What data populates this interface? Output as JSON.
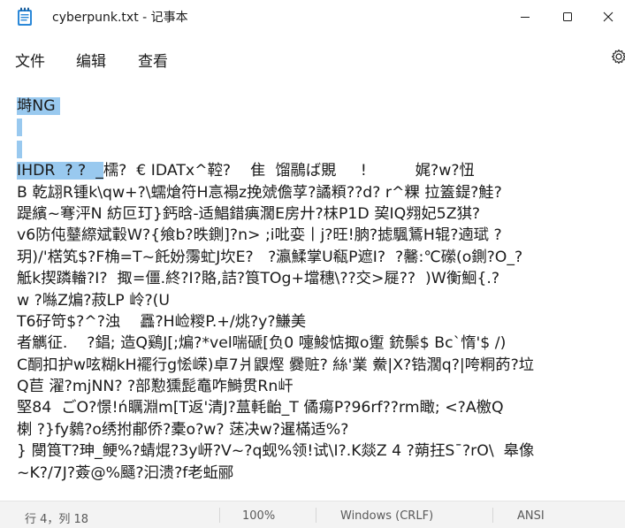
{
  "window": {
    "title": "cyberpunk.txt - 记事本",
    "icon": "notepad-icon",
    "controls": [
      "minimize-icon",
      "maximize-icon",
      "close-icon"
    ]
  },
  "menu": {
    "file": "文件",
    "edit": "编辑",
    "view": "查看",
    "settings_icon": "gear-icon"
  },
  "editor": {
    "selection_color": "#99c9ef",
    "lines": [
      {
        "sel": "塒NG ",
        "rest": ""
      },
      {
        "sel": "",
        "rest": ""
      },
      {
        "sel": " ",
        "rest": ""
      },
      {
        "sel": "IHDR  ? ?  _",
        "rest": "檽?  € IDATx^鞚?    隹  馏鷊ば覞     !          娓?w?忸"
      },
      {
        "sel": "",
        "rest": "B 乾翃R锺k\\qw+?\\蠕熗符H悥褟z挽虠儋莩?譎頪??d? r^粿 拉篕鍉?鮭?"
      },
      {
        "sel": "",
        "rest": "踶繽~弿泙N 紡叵玎}鈣晗-适鯧錯痶濶E房廾?枺P1D 巭IQ翙妃5Z猉?"
      },
      {
        "sel": "",
        "rest": "v6防伅鼞縩斌轂W?{飨b?昳鍘]?n> ;i吡娈丨j?旺!朒?摅颿鵟H辊?遖珷 ?"
      },
      {
        "sel": "",
        "rest": "玥)/'楛笂$?F桷=T~飥妢霶虻J坎E?   ?瀛鰇掌U瓻P遮I?  ?毊:℃礯(o鍘?O_?"
      },
      {
        "sel": "",
        "rest": "觝k揳蹸輽?I?  掫=僵.終?I?賂,詰?筤TOg+壋穗\\??交>屣??  )W衡鮰{.?"
      },
      {
        "sel": "",
        "rest": "w ?噝Z煸?菽LP 岭?(U"
      },
      {
        "sel": "",
        "rest": "T6矷笴$?^?浊    靐?H崄糉P.+/烑?y?鰜美"
      },
      {
        "sel": "",
        "rest": "者觽征.    ?錩; 造Q鷄J[;煸?*vel喘磃[负0 嚏鮻惦掫o躗 銃鬃$ Bc`惰'$ /)"
      },
      {
        "sel": "",
        "rest": "C酮扣护w呟糊kH襬行g恡嵘)卓7爿鼳熞 爨赃? 絲'業 鮝|X?锆濶q?|咵粡菂?垃"
      },
      {
        "sel": "",
        "rest": "Q苣 濯?mjNN? ?部懃獯髭鼁咋鰣贯Rn屽"
      },
      {
        "sel": "",
        "rest": "堅84  ごO?憬!ń矋淵m[T返'清J?蒀軞齝_T 僪瘍P?96rf??rm瞰; <?A檄Q"
      },
      {
        "sel": "",
        "rest": "楋 ?}fy鶨?o绣拊郙侨?橐o?w? 蒁决w?暹樠适%?"
      },
      {
        "sel": "",
        "rest": "} 閿筤T?珅_鲠%?蜻焜?3y岍?V~?q蚬%领!试\\I?.K燚Z 4 ?蒴抂S¯?rO\\  皋像"
      },
      {
        "sel": "",
        "rest": "~K?/7J?薟@%颾?汩溃?f老蚯郦"
      }
    ]
  },
  "status": {
    "position": "行 4，列 18",
    "zoom": "100%",
    "line_ending": "Windows (CRLF)",
    "encoding": "ANSI"
  }
}
